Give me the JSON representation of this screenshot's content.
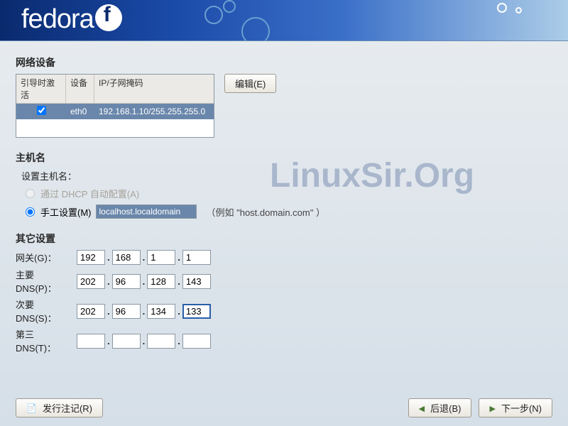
{
  "header": {
    "logo_text": "fedora"
  },
  "network_devices": {
    "title": "网络设备",
    "columns": {
      "active": "引导时激活",
      "device": "设备",
      "ipmask": "IP/子网掩码"
    },
    "row": {
      "active": true,
      "device": "eth0",
      "ipmask": "192.168.1.10/255.255.255.0"
    },
    "edit_btn": "编辑(E)"
  },
  "hostname": {
    "title": "主机名",
    "set_label": "设置主机名：",
    "dhcp_label": "通过 DHCP 自动配置(A)",
    "manual_label": "手工设置(M)",
    "manual_value": "localhost.localdomain",
    "hint": "（例如 \"host.domain.com\" ）"
  },
  "other": {
    "title": "其它设置",
    "gateway_label": "网关(G)：",
    "primary_dns_label": "主要 DNS(P)：",
    "secondary_dns_label": "次要 DNS(S)：",
    "tertiary_dns_label": "第三 DNS(T)：",
    "gateway": [
      "192",
      "168",
      "1",
      "1"
    ],
    "primary_dns": [
      "202",
      "96",
      "128",
      "143"
    ],
    "secondary_dns": [
      "202",
      "96",
      "134",
      "133"
    ],
    "tertiary_dns": [
      "",
      "",
      "",
      ""
    ]
  },
  "footer": {
    "release_notes": "发行注记(R)",
    "back": "后退(B)",
    "next": "下一步(N)"
  },
  "watermarks": {
    "linuxsir": "LinuxSir.Org"
  }
}
